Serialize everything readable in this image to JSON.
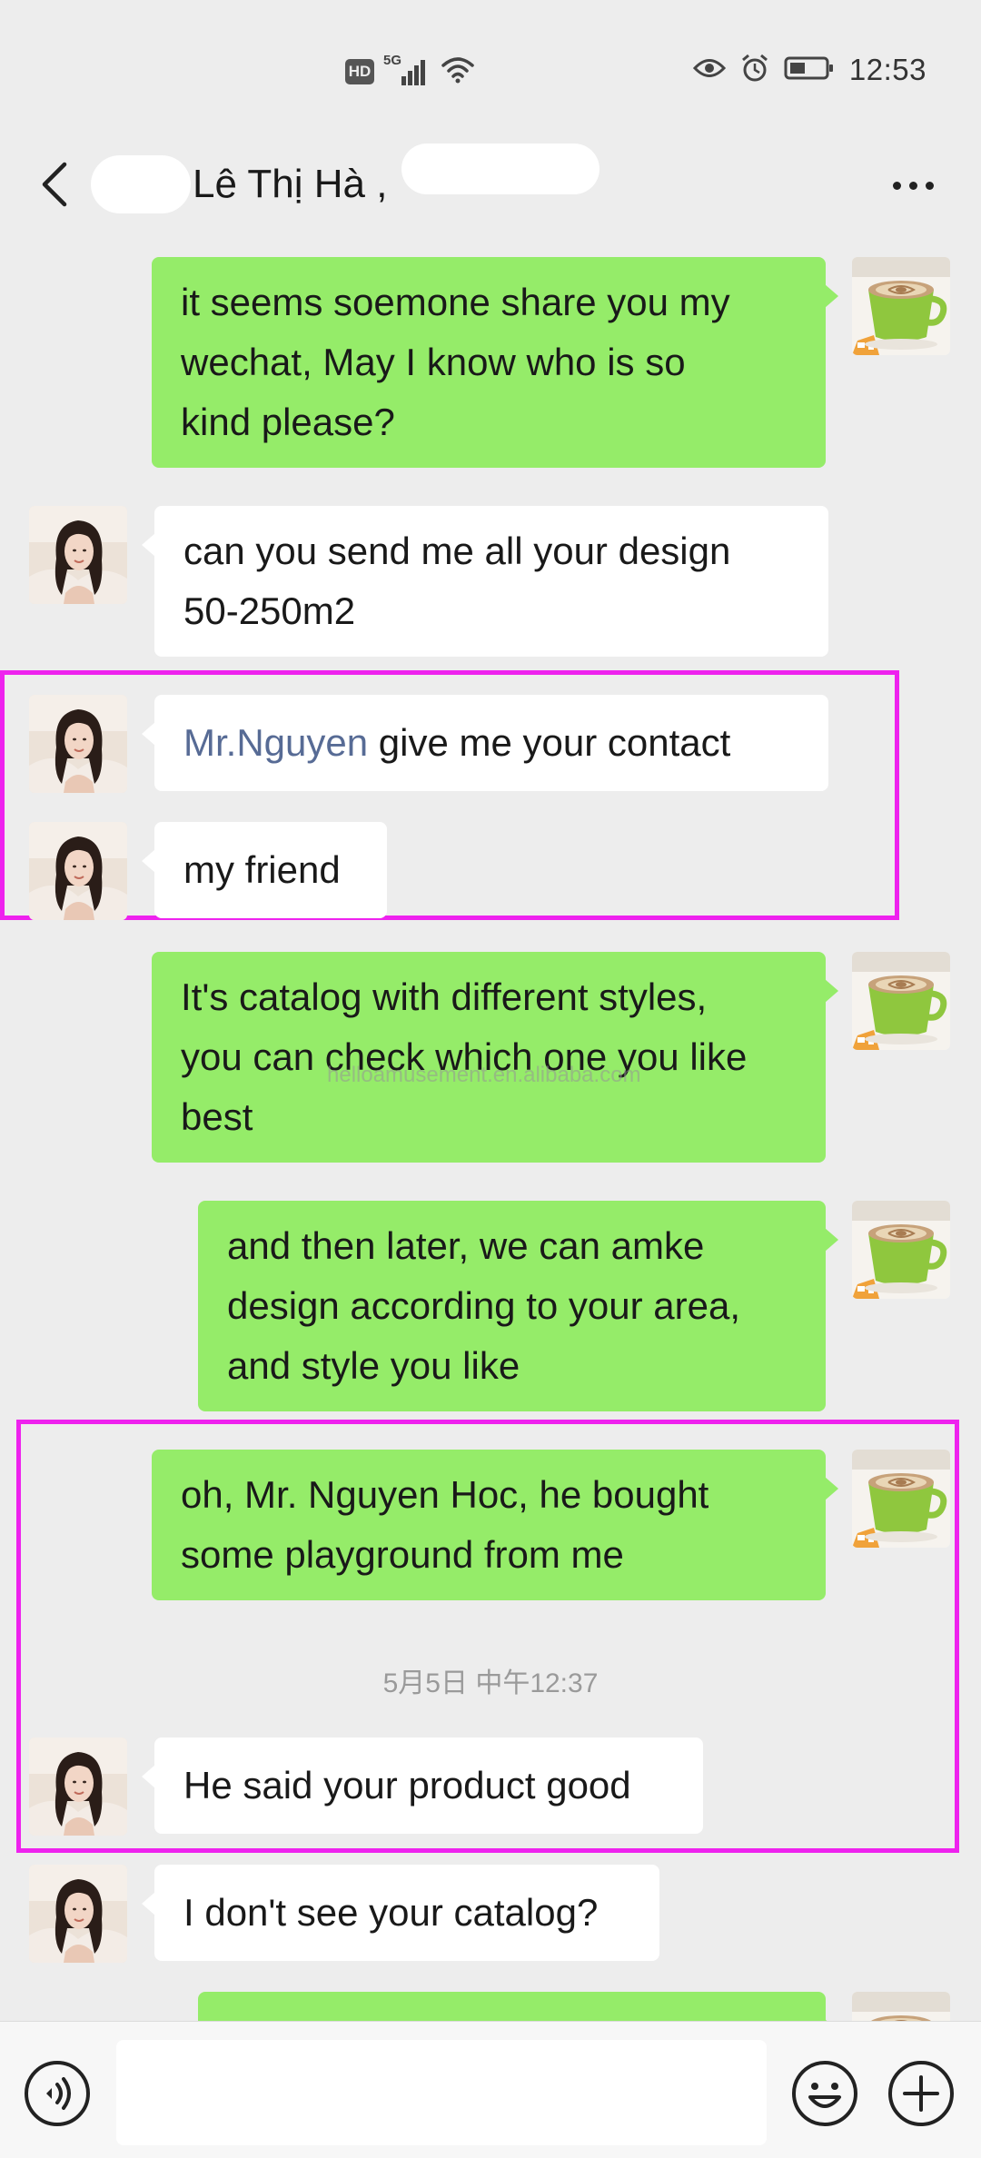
{
  "status_bar": {
    "hd_badge": "HD",
    "network": "5G",
    "time": "12:53"
  },
  "header": {
    "title": "Lê Thị Hà ,"
  },
  "messages": [
    {
      "side": "out",
      "lines": [
        "it seems soemone share you my",
        "wechat, May I know who is so",
        "kind please?"
      ]
    },
    {
      "side": "in",
      "lines": [
        "can you send me all your design",
        "50-250m2"
      ]
    },
    {
      "side": "in",
      "mention": "Mr.Nguyen",
      "text": " give me your contact"
    },
    {
      "side": "in",
      "lines": [
        "my friend"
      ]
    },
    {
      "side": "out",
      "lines": [
        "It's catalog with different styles,",
        "you can check which one you like",
        "best"
      ]
    },
    {
      "side": "out",
      "lines": [
        "and then later, we can amke",
        "design according to your area,",
        "and style you like"
      ]
    },
    {
      "side": "out",
      "lines": [
        "oh,  Mr. Nguyen  Hoc, he bought",
        "some playground from me"
      ]
    },
    {
      "side": "in",
      "lines": [
        "He said your product good"
      ]
    },
    {
      "side": "in",
      "lines": [
        "I don't see your catalog?"
      ]
    }
  ],
  "timestamp": "5月5日 中午12:37",
  "watermark": "helloamusement.en.alibaba.com",
  "icons": {
    "back": "chevron-left-icon",
    "more": "more-dots-icon",
    "voice": "voice-icon",
    "emoji": "emoji-icon",
    "plus": "plus-icon"
  },
  "colors": {
    "background": "#ededed",
    "outgoing_bubble": "#95ec69",
    "incoming_bubble": "#ffffff",
    "mention": "#576b95",
    "highlight": "#ee22ee"
  }
}
